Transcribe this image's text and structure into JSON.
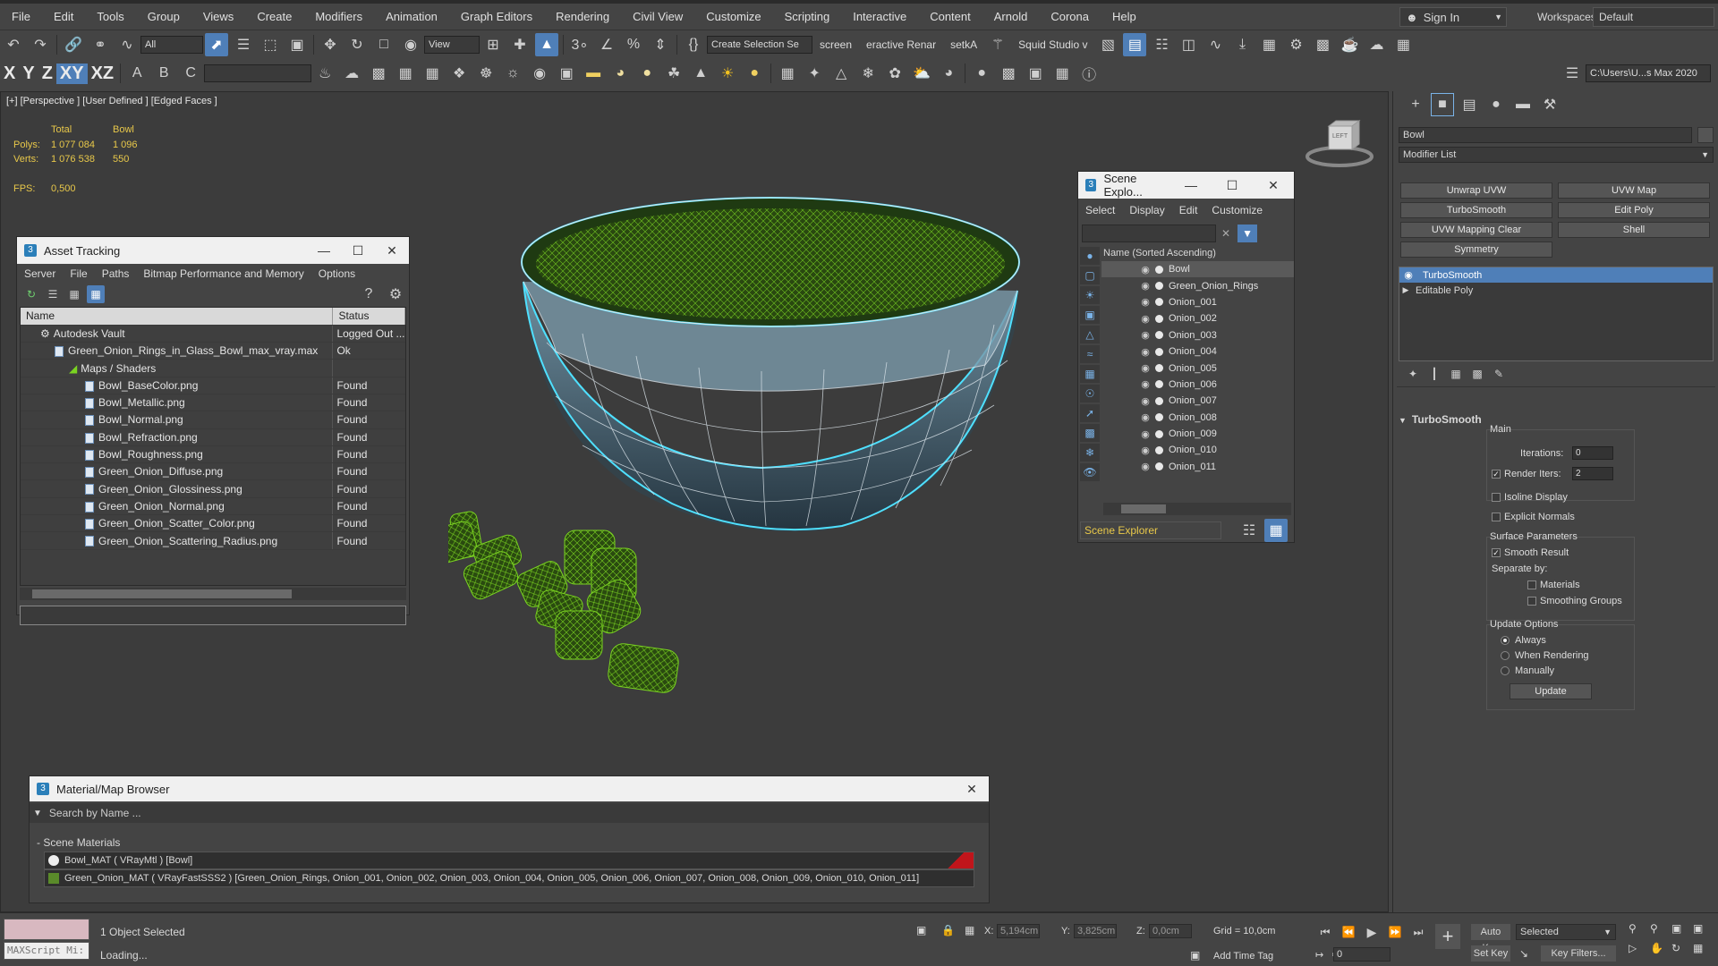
{
  "menu": [
    "File",
    "Edit",
    "Tools",
    "Group",
    "Views",
    "Create",
    "Modifiers",
    "Animation",
    "Graph Editors",
    "Rendering",
    "Civil View",
    "Customize",
    "Scripting",
    "Interactive",
    "Content",
    "Arnold",
    "Corona",
    "Help"
  ],
  "signin": "Sign In",
  "workspace_label": "Workspaces:",
  "workspace_value": "Default",
  "toolbar": {
    "filter_select": "All",
    "view_select": "View",
    "create_selection": "Create Selection Se",
    "screen": "screen",
    "interactive_render": "eractive Renar",
    "setka": "setkA",
    "squid": "Squid Studio v",
    "axes": [
      "X",
      "Y",
      "Z",
      "XY",
      "XZ"
    ],
    "path_select": "C:\\Users\\U...s Max 2020"
  },
  "viewport": {
    "label": "[+] [Perspective ] [User Defined ] [Edged Faces ]",
    "stats_total": "Total",
    "stats_object": "Bowl",
    "polys_label": "Polys:",
    "polys_total": "1 077 084",
    "polys_object": "1 096",
    "verts_label": "Verts:",
    "verts_total": "1 076 538",
    "verts_object": "550",
    "fps_label": "FPS:",
    "fps_value": "0,500",
    "viewcube": "LEFT"
  },
  "asset_tracking": {
    "title": "Asset Tracking",
    "menu": [
      "Server",
      "File",
      "Paths",
      "Bitmap Performance and Memory",
      "Options"
    ],
    "col_name": "Name",
    "col_status": "Status",
    "rows": [
      {
        "name": "Autodesk Vault",
        "status": "Logged Out ..."
      },
      {
        "name": "Green_Onion_Rings_in_Glass_Bowl_max_vray.max",
        "status": "Ok"
      },
      {
        "name": "Maps / Shaders",
        "status": ""
      },
      {
        "name": "Bowl_BaseColor.png",
        "status": "Found"
      },
      {
        "name": "Bowl_Metallic.png",
        "status": "Found"
      },
      {
        "name": "Bowl_Normal.png",
        "status": "Found"
      },
      {
        "name": "Bowl_Refraction.png",
        "status": "Found"
      },
      {
        "name": "Bowl_Roughness.png",
        "status": "Found"
      },
      {
        "name": "Green_Onion_Diffuse.png",
        "status": "Found"
      },
      {
        "name": "Green_Onion_Glossiness.png",
        "status": "Found"
      },
      {
        "name": "Green_Onion_Normal.png",
        "status": "Found"
      },
      {
        "name": "Green_Onion_Scatter_Color.png",
        "status": "Found"
      },
      {
        "name": "Green_Onion_Scattering_Radius.png",
        "status": "Found"
      }
    ]
  },
  "scene_explorer": {
    "title": "Scene Explo...",
    "menu": [
      "Select",
      "Display",
      "Edit",
      "Customize"
    ],
    "header": "Name (Sorted Ascending)",
    "items": [
      "Bowl",
      "Green_Onion_Rings",
      "Onion_001",
      "Onion_002",
      "Onion_003",
      "Onion_004",
      "Onion_005",
      "Onion_006",
      "Onion_007",
      "Onion_008",
      "Onion_009",
      "Onion_010",
      "Onion_011"
    ],
    "footer": "Scene Explorer"
  },
  "command_panel": {
    "object_name": "Bowl",
    "modifier_list": "Modifier List",
    "buttons": [
      "Unwrap UVW",
      "UVW Map",
      "TurboSmooth",
      "Edit Poly",
      "UVW Mapping Clear",
      "Shell",
      "Symmetry"
    ],
    "stack": [
      "TurboSmooth",
      "Editable Poly"
    ],
    "rollout_title": "TurboSmooth",
    "main": "Main",
    "iterations_label": "Iterations:",
    "iterations_value": "0",
    "render_iters_label": "Render Iters:",
    "render_iters_value": "2",
    "isoline": "Isoline Display",
    "explicit_normals": "Explicit Normals",
    "surface_params": "Surface Parameters",
    "smooth_result": "Smooth Result",
    "separate_by": "Separate by:",
    "materials": "Materials",
    "smoothing_groups": "Smoothing Groups",
    "update_options": "Update Options",
    "always": "Always",
    "when_rendering": "When Rendering",
    "manually": "Manually",
    "update": "Update"
  },
  "material_browser": {
    "title": "Material/Map Browser",
    "search_placeholder": "Search by Name ...",
    "section": "- Scene Materials",
    "materials": [
      "Bowl_MAT ( VRayMtl ) [Bowl]",
      "Green_Onion_MAT ( VRayFastSSS2 ) [Green_Onion_Rings, Onion_001, Onion_002, Onion_003, Onion_004, Onion_005, Onion_006, Onion_007, Onion_008, Onion_009, Onion_010, Onion_011]"
    ]
  },
  "status_bar": {
    "maxscript": "MAXScript Mi:",
    "selection": "1 Object Selected",
    "loading": "Loading...",
    "x_label": "X:",
    "x_value": "5,194cm",
    "y_label": "Y:",
    "y_value": "3,825cm",
    "z_label": "Z:",
    "z_value": "0,0cm",
    "grid": "Grid = 10,0cm",
    "add_time_tag": "Add Time Tag",
    "auto_key": "Auto Key",
    "set_key": "Set Key",
    "selected": "Selected",
    "key_filters": "Key Filters...",
    "frame": "0"
  },
  "colors": {
    "accent": "#4f7fb8",
    "stats": "#e8c84a",
    "wire_bowl": "#4fe0ff",
    "wire_onion": "#7ad321"
  }
}
